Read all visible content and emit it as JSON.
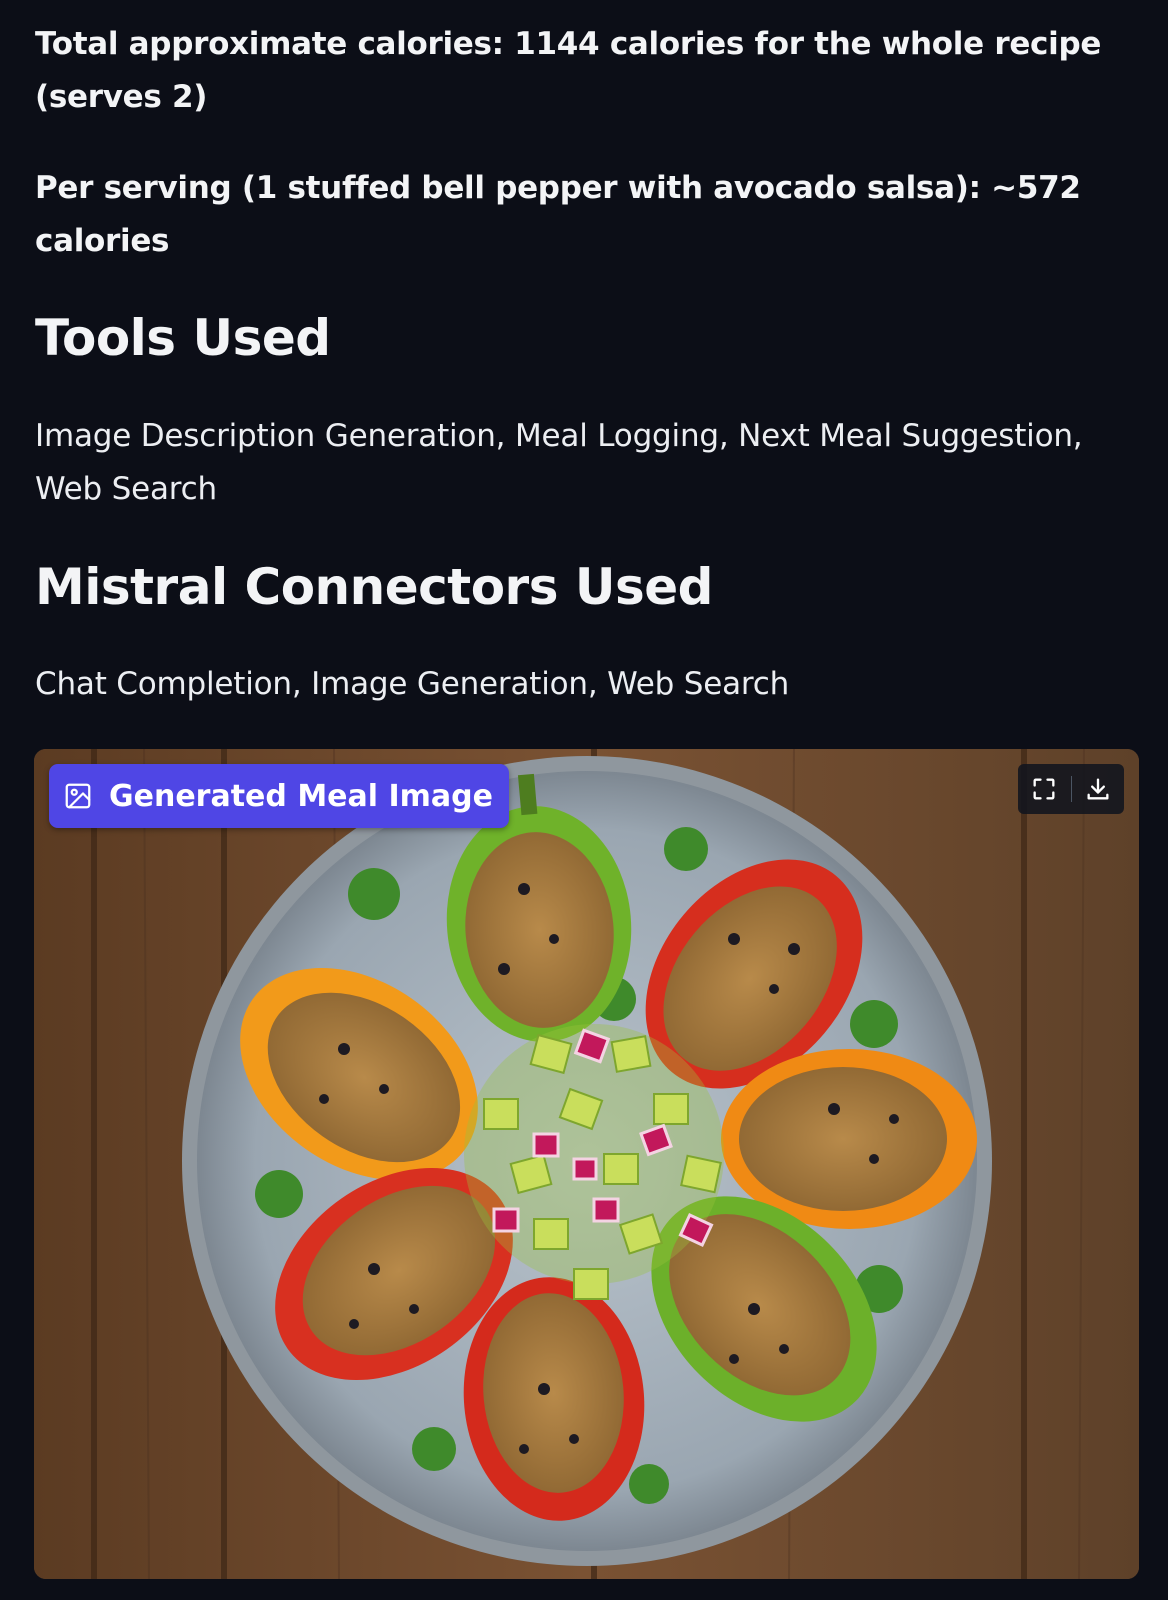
{
  "summary": {
    "total_calories": "Total approximate calories: 1144 calories for the whole recipe (serves 2)",
    "per_serving": "Per serving (1 stuffed bell pepper with avocado salsa): ~572 calories"
  },
  "tools": {
    "heading": "Tools Used",
    "list": "Image Description Generation, Meal Logging, Next Meal Suggestion, Web Search"
  },
  "connectors": {
    "heading": "Mistral Connectors Used",
    "list": "Chat Completion, Image Generation, Web Search"
  },
  "image_card": {
    "badge_label": "Generated Meal Image",
    "badge_icon": "image-icon",
    "actions": [
      {
        "icon": "fullscreen-icon"
      },
      {
        "icon": "download-icon"
      }
    ]
  },
  "colors": {
    "background": "#0c0e17",
    "text": "#f3f4f6",
    "badge": "#4f46e5"
  }
}
